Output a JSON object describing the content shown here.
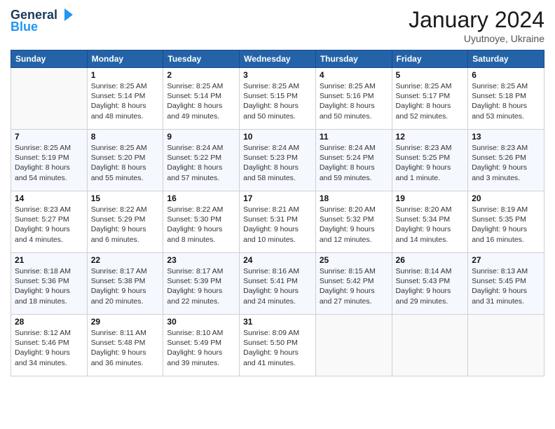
{
  "header": {
    "logo": {
      "line1": "General",
      "line2": "Blue"
    },
    "title": "January 2024",
    "subtitle": "Uyutnoye, Ukraine"
  },
  "weekdays": [
    "Sunday",
    "Monday",
    "Tuesday",
    "Wednesday",
    "Thursday",
    "Friday",
    "Saturday"
  ],
  "weeks": [
    [
      {
        "day": "",
        "sunrise": "",
        "sunset": "",
        "daylight": ""
      },
      {
        "day": "1",
        "sunrise": "8:25 AM",
        "sunset": "5:14 PM",
        "daylight": "8 hours and 48 minutes."
      },
      {
        "day": "2",
        "sunrise": "8:25 AM",
        "sunset": "5:14 PM",
        "daylight": "8 hours and 49 minutes."
      },
      {
        "day": "3",
        "sunrise": "8:25 AM",
        "sunset": "5:15 PM",
        "daylight": "8 hours and 50 minutes."
      },
      {
        "day": "4",
        "sunrise": "8:25 AM",
        "sunset": "5:16 PM",
        "daylight": "8 hours and 50 minutes."
      },
      {
        "day": "5",
        "sunrise": "8:25 AM",
        "sunset": "5:17 PM",
        "daylight": "8 hours and 52 minutes."
      },
      {
        "day": "6",
        "sunrise": "8:25 AM",
        "sunset": "5:18 PM",
        "daylight": "8 hours and 53 minutes."
      }
    ],
    [
      {
        "day": "7",
        "sunrise": "8:25 AM",
        "sunset": "5:19 PM",
        "daylight": "8 hours and 54 minutes."
      },
      {
        "day": "8",
        "sunrise": "8:25 AM",
        "sunset": "5:20 PM",
        "daylight": "8 hours and 55 minutes."
      },
      {
        "day": "9",
        "sunrise": "8:24 AM",
        "sunset": "5:22 PM",
        "daylight": "8 hours and 57 minutes."
      },
      {
        "day": "10",
        "sunrise": "8:24 AM",
        "sunset": "5:23 PM",
        "daylight": "8 hours and 58 minutes."
      },
      {
        "day": "11",
        "sunrise": "8:24 AM",
        "sunset": "5:24 PM",
        "daylight": "8 hours and 59 minutes."
      },
      {
        "day": "12",
        "sunrise": "8:23 AM",
        "sunset": "5:25 PM",
        "daylight": "9 hours and 1 minute."
      },
      {
        "day": "13",
        "sunrise": "8:23 AM",
        "sunset": "5:26 PM",
        "daylight": "9 hours and 3 minutes."
      }
    ],
    [
      {
        "day": "14",
        "sunrise": "8:23 AM",
        "sunset": "5:27 PM",
        "daylight": "9 hours and 4 minutes."
      },
      {
        "day": "15",
        "sunrise": "8:22 AM",
        "sunset": "5:29 PM",
        "daylight": "9 hours and 6 minutes."
      },
      {
        "day": "16",
        "sunrise": "8:22 AM",
        "sunset": "5:30 PM",
        "daylight": "9 hours and 8 minutes."
      },
      {
        "day": "17",
        "sunrise": "8:21 AM",
        "sunset": "5:31 PM",
        "daylight": "9 hours and 10 minutes."
      },
      {
        "day": "18",
        "sunrise": "8:20 AM",
        "sunset": "5:32 PM",
        "daylight": "9 hours and 12 minutes."
      },
      {
        "day": "19",
        "sunrise": "8:20 AM",
        "sunset": "5:34 PM",
        "daylight": "9 hours and 14 minutes."
      },
      {
        "day": "20",
        "sunrise": "8:19 AM",
        "sunset": "5:35 PM",
        "daylight": "9 hours and 16 minutes."
      }
    ],
    [
      {
        "day": "21",
        "sunrise": "8:18 AM",
        "sunset": "5:36 PM",
        "daylight": "9 hours and 18 minutes."
      },
      {
        "day": "22",
        "sunrise": "8:17 AM",
        "sunset": "5:38 PM",
        "daylight": "9 hours and 20 minutes."
      },
      {
        "day": "23",
        "sunrise": "8:17 AM",
        "sunset": "5:39 PM",
        "daylight": "9 hours and 22 minutes."
      },
      {
        "day": "24",
        "sunrise": "8:16 AM",
        "sunset": "5:41 PM",
        "daylight": "9 hours and 24 minutes."
      },
      {
        "day": "25",
        "sunrise": "8:15 AM",
        "sunset": "5:42 PM",
        "daylight": "9 hours and 27 minutes."
      },
      {
        "day": "26",
        "sunrise": "8:14 AM",
        "sunset": "5:43 PM",
        "daylight": "9 hours and 29 minutes."
      },
      {
        "day": "27",
        "sunrise": "8:13 AM",
        "sunset": "5:45 PM",
        "daylight": "9 hours and 31 minutes."
      }
    ],
    [
      {
        "day": "28",
        "sunrise": "8:12 AM",
        "sunset": "5:46 PM",
        "daylight": "9 hours and 34 minutes."
      },
      {
        "day": "29",
        "sunrise": "8:11 AM",
        "sunset": "5:48 PM",
        "daylight": "9 hours and 36 minutes."
      },
      {
        "day": "30",
        "sunrise": "8:10 AM",
        "sunset": "5:49 PM",
        "daylight": "9 hours and 39 minutes."
      },
      {
        "day": "31",
        "sunrise": "8:09 AM",
        "sunset": "5:50 PM",
        "daylight": "9 hours and 41 minutes."
      },
      {
        "day": "",
        "sunrise": "",
        "sunset": "",
        "daylight": ""
      },
      {
        "day": "",
        "sunrise": "",
        "sunset": "",
        "daylight": ""
      },
      {
        "day": "",
        "sunrise": "",
        "sunset": "",
        "daylight": ""
      }
    ]
  ],
  "labels": {
    "sunrise_prefix": "Sunrise: ",
    "sunset_prefix": "Sunset: ",
    "daylight_prefix": "Daylight: "
  }
}
